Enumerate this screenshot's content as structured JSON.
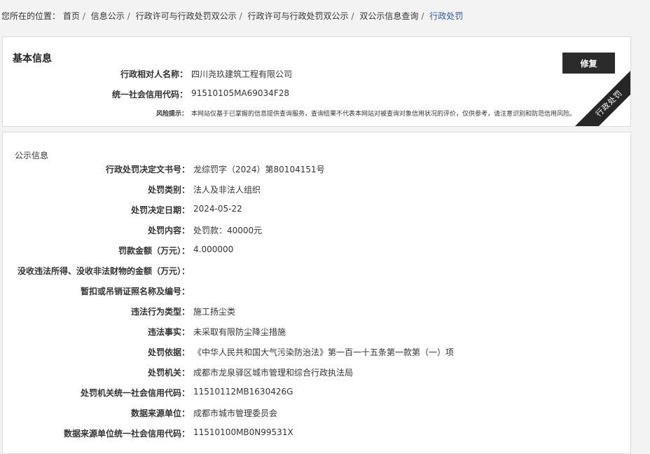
{
  "breadcrumb": {
    "prefix": "您所在的位置：",
    "items": [
      "首页",
      "信息公示",
      "行政许可与行政处罚双公示",
      "行政许可与行政处罚双公示",
      "双公示信息查询"
    ],
    "current": "行政处罚",
    "separator": "/"
  },
  "basic": {
    "title": "基本信息",
    "repair_label": "修复",
    "ribbon": "行政处罚",
    "rows": [
      {
        "label": "行政相对人名称：",
        "value": "四川尧玖建筑工程有限公司"
      },
      {
        "label": "统一社会信用代码：",
        "value": "91510105MA69034F28"
      }
    ],
    "risk_label": "风险提示：",
    "risk_text": "本网站仅基于已掌握的信息提供查询服务，查询结果不代表本网站对被查询对象信用状况的评价，仅供参考，请注意识别和防范信用风险。"
  },
  "public": {
    "title": "公示信息",
    "rows": [
      {
        "label": "行政处罚决定文书号：",
        "value": "龙综罚字（2024）第80104151号"
      },
      {
        "label": "处罚类别：",
        "value": "法人及非法人组织"
      },
      {
        "label": "处罚决定日期：",
        "value": "2024-05-22"
      },
      {
        "label": "处罚内容：",
        "value": "处罚款：40000元"
      },
      {
        "label": "罚款金额（万元）：",
        "value": "4.000000"
      },
      {
        "label": "没收违法所得、没收非法财物的金额（万元）：",
        "value": ""
      },
      {
        "label": "暂扣或吊销证照名称及编号：",
        "value": ""
      },
      {
        "label": "违法行为类型：",
        "value": "施工扬尘类"
      },
      {
        "label": "违法事实：",
        "value": "未采取有限防尘降尘措施"
      },
      {
        "label": "处罚依据：",
        "value": "《中华人民共和国大气污染防治法》第一百一十五条第一款第（一）项"
      },
      {
        "label": "处罚机关：",
        "value": "成都市龙泉驿区城市管理和综合行政执法局"
      },
      {
        "label": "处罚机关统一社会信用代码：",
        "value": "11510112MB1630426G"
      },
      {
        "label": "数据来源单位：",
        "value": "成都市城市管理委员会"
      },
      {
        "label": "数据来源单位统一社会信用代码：",
        "value": "11510100MB0N99531X"
      }
    ]
  }
}
